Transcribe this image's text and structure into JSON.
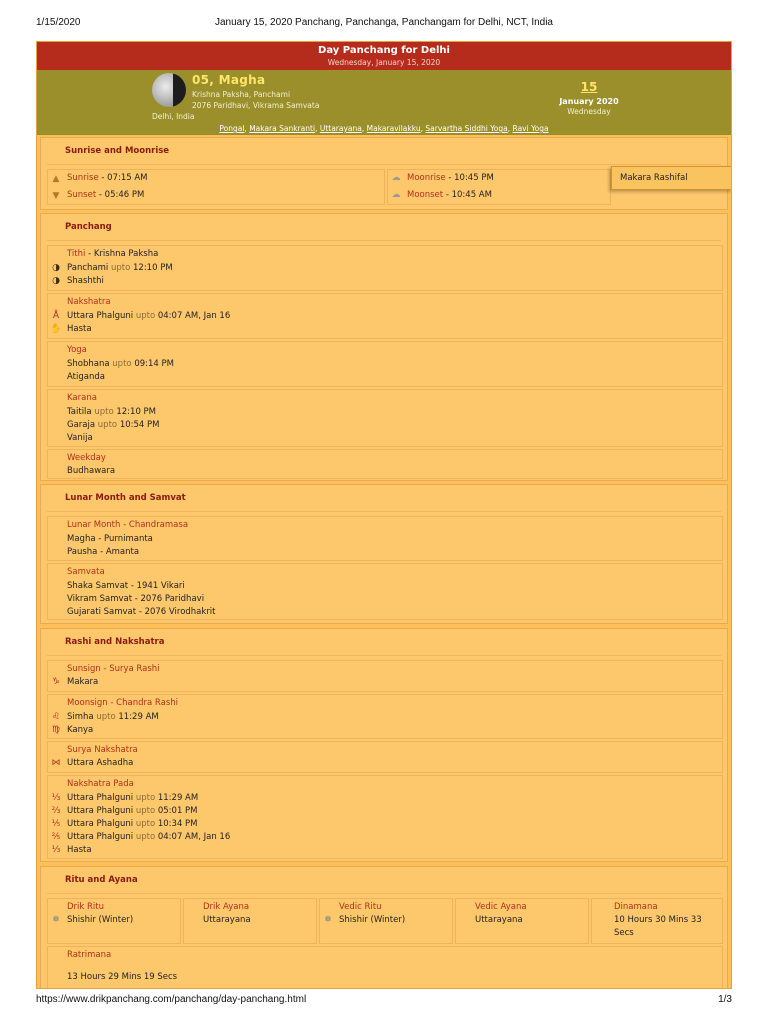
{
  "print_header": {
    "date": "1/15/2020",
    "title": "January 15, 2020 Panchang, Panchanga, Panchangam for Delhi, NCT, India"
  },
  "print_footer": {
    "url": "https://www.drikpanchang.com/panchang/day-panchang.html",
    "page": "1/3"
  },
  "banner": {
    "title": "Day Panchang for Delhi",
    "subtitle": "Wednesday, January 15, 2020"
  },
  "summary": {
    "tithi_title": "05, Magha",
    "paksha_line": "Krishna Paksha, Panchami",
    "samvata_line": "2076 Paridhavi, Vikrama Samvata",
    "place": "Delhi, India",
    "day_number": "15",
    "month_year": "January 2020",
    "weekday": "Wednesday",
    "festivals": [
      "Pongal",
      "Makara Sankranti",
      "Uttarayana",
      "Makaravilakku",
      "Sarvartha Siddhi Yoga",
      "Ravi Yoga"
    ]
  },
  "sunrise_moonrise": {
    "title": "Sunrise and Moonrise",
    "sunrise_label": "Sunrise",
    "sunrise_value": "07:15 AM",
    "sunset_label": "Sunset",
    "sunset_value": "05:46 PM",
    "moonrise_label": "Moonrise",
    "moonrise_value": "10:45 PM",
    "moonset_label": "Moonset",
    "moonset_value": "10:45 AM",
    "sep": " - "
  },
  "rashifal_button": "Makara Rashifal",
  "panchang": {
    "title": "Panchang",
    "tithi": {
      "label": "Tithi",
      "extra": " - Krishna Paksha",
      "l1_name": "Panchami",
      "l1_upto": " upto ",
      "l1_time": "12:10 PM",
      "l2": "Shashthi"
    },
    "nakshatra": {
      "label": "Nakshatra",
      "l1_name": "Uttara Phalguni",
      "l1_upto": " upto ",
      "l1_time": "04:07 AM, Jan 16",
      "l2": "Hasta"
    },
    "yoga": {
      "label": "Yoga",
      "l1_name": "Shobhana",
      "l1_upto": " upto ",
      "l1_time": "09:14 PM",
      "l2": "Atiganda"
    },
    "karana": {
      "label": "Karana",
      "l1_name": "Taitila",
      "l1_upto": " upto ",
      "l1_time": "12:10 PM",
      "l2_name": "Garaja",
      "l2_upto": " upto ",
      "l2_time": "10:54 PM",
      "l3": "Vanija"
    },
    "weekday": {
      "label": "Weekday",
      "value": "Budhawara"
    }
  },
  "lunar_month": {
    "title": "Lunar Month and Samvat",
    "lunar": {
      "label": "Lunar Month - Chandramasa",
      "l1": "Magha - Purnimanta",
      "l2": "Pausha - Amanta"
    },
    "samvata": {
      "label": "Samvata",
      "l1": "Shaka Samvat - 1941 Vikari",
      "l2": "Vikram Samvat - 2076 Paridhavi",
      "l3": "Gujarati Samvat - 2076 Virodhakrit"
    }
  },
  "rashi": {
    "title": "Rashi and Nakshatra",
    "sunsign": {
      "label": "Sunsign - Surya Rashi",
      "value": "Makara"
    },
    "moonsign": {
      "label": "Moonsign - Chandra Rashi",
      "l1_name": "Simha",
      "l1_upto": " upto ",
      "l1_time": "11:29 AM",
      "l2": "Kanya"
    },
    "surya_nakshatra": {
      "label": "Surya Nakshatra",
      "value": "Uttara Ashadha"
    },
    "pada": {
      "label": "Nakshatra Pada",
      "rows": [
        {
          "name": "Uttara Phalguni",
          "upto": " upto ",
          "time": "11:29 AM"
        },
        {
          "name": "Uttara Phalguni",
          "upto": " upto ",
          "time": "05:01 PM"
        },
        {
          "name": "Uttara Phalguni",
          "upto": " upto ",
          "time": "10:34 PM"
        },
        {
          "name": "Uttara Phalguni",
          "upto": " upto ",
          "time": "04:07 AM, Jan 16"
        }
      ],
      "last": "Hasta"
    }
  },
  "ritu": {
    "title": "Ritu and Ayana",
    "drik_ritu": {
      "label": "Drik Ritu",
      "value": "Shishir (Winter)"
    },
    "drik_ayana": {
      "label": "Drik Ayana",
      "value": "Uttarayana"
    },
    "vedic_ritu": {
      "label": "Vedic Ritu",
      "value": "Shishir (Winter)"
    },
    "vedic_ayana": {
      "label": "Vedic Ayana",
      "value": "Uttarayana"
    },
    "dinamana": {
      "label": "Dinamana",
      "l1": "10 Hours 30 Mins 33",
      "l2": "Secs"
    },
    "ratrimana": {
      "label": "Ratrimana",
      "value": "13 Hours 29 Mins 19 Secs"
    }
  },
  "icons": {
    "sunrise": "sunrise-icon",
    "sunset": "sunset-icon",
    "moonrise": "moonrise-icon",
    "moonset": "moonset-icon",
    "tithi": "moon-phase-icon",
    "nakshatra": "nakshatra-icon",
    "zodiac": "zodiac-icon",
    "season": "snowflake-icon"
  },
  "colors": {
    "page_bg": "#fdbf59",
    "banner_red": "#b62c1c",
    "summary_olive": "#9a8f2b",
    "label_red": "#b0301c"
  }
}
